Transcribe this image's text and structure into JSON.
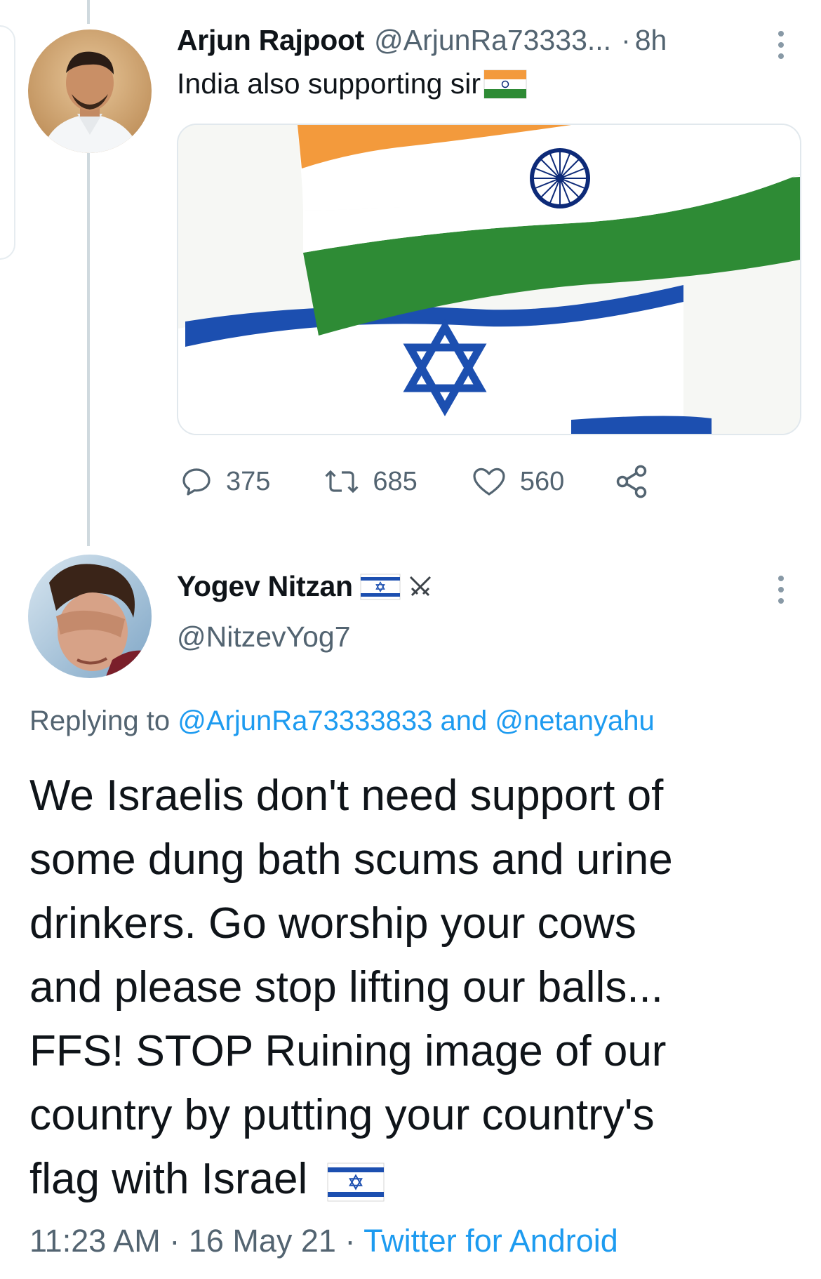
{
  "tweet1": {
    "display_name": "Arjun Rajpoot",
    "handle": "@ArjunRa73333...",
    "separator": "·",
    "time": "8h",
    "text": "India also supporting sir",
    "emoji": "india-flag-emoji",
    "media_icons": [
      "india-flag",
      "israel-flag"
    ],
    "stats": {
      "replies": "375",
      "retweets": "685",
      "likes": "560"
    }
  },
  "tweet2": {
    "display_name": "Yogev Nitzan",
    "name_emojis": [
      "israel-flag-emoji",
      "crossed-swords-emoji"
    ],
    "handle": "@NitzevYog7",
    "replying_label": "Replying to",
    "replying_user1": "@ArjunRa73333833",
    "replying_and": "and",
    "replying_user2": "@netanyahu",
    "text_lines": [
      "We Israelis don't need support of",
      "some dung bath scums and urine",
      "drinkers. Go worship your cows",
      "and please stop lifting our balls...",
      "FFS! STOP Ruining image of our",
      "country by putting your country's",
      "flag with Israel"
    ],
    "footer_time": "11:23 AM",
    "footer_date": "16 May 21",
    "footer_sep": "·",
    "footer_source": "Twitter for Android"
  },
  "colors": {
    "text": "#0f1419",
    "secondary": "#536471",
    "link": "#1d9bf0",
    "line": "#cfd9de",
    "saffron": "#f39a3c",
    "india_green": "#2e8b35",
    "israel_blue": "#1c4fb0",
    "chakra": "#0d2a78"
  },
  "icons": [
    "reply-icon",
    "retweet-icon",
    "like-icon",
    "share-icon",
    "more-icon"
  ]
}
